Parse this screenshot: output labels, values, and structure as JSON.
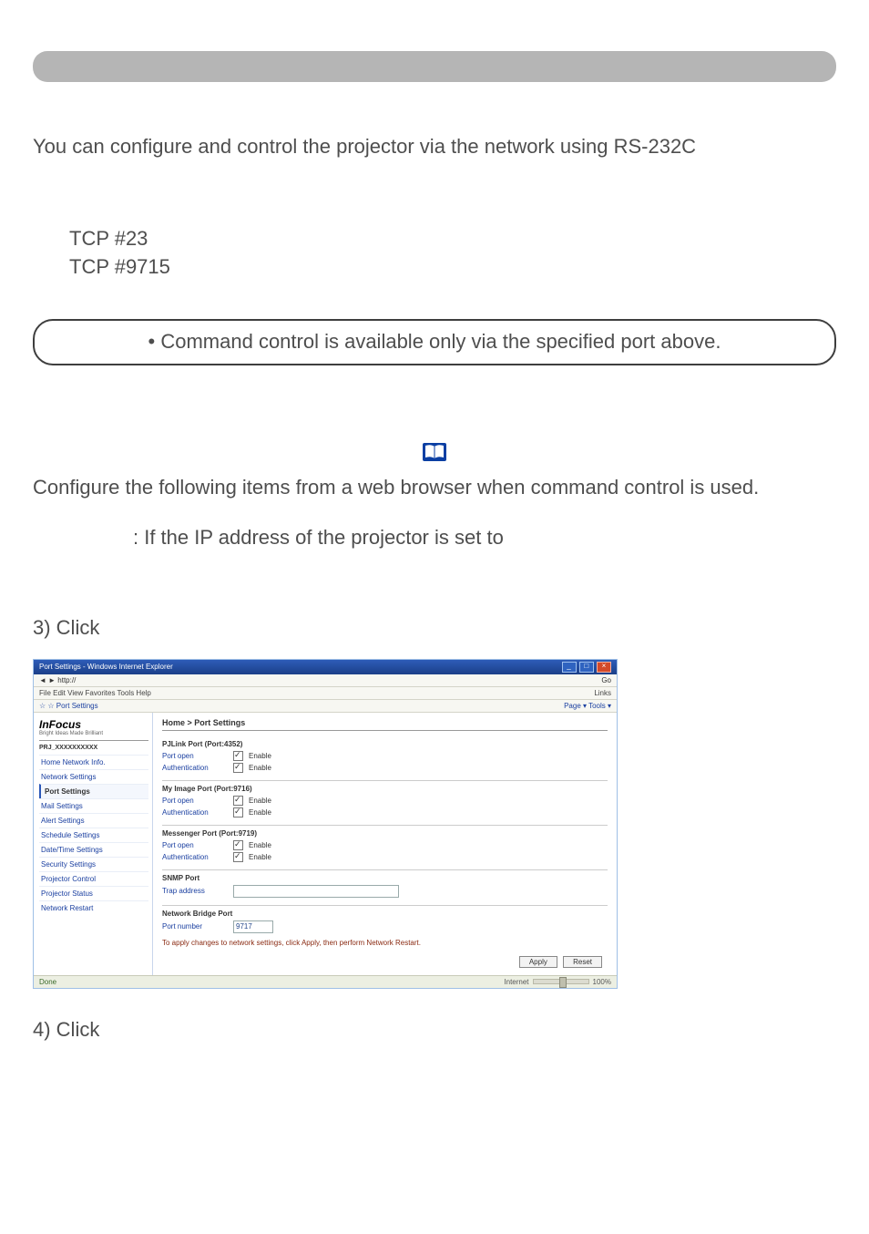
{
  "intro": "You can configure and control the projector via the network using RS-232C",
  "ports": {
    "tcp23": "TCP #23",
    "tcp9715": "TCP #9715"
  },
  "note_box": "• Command control is available only via the specified port above.",
  "configure_line": "Configure the following items from a web browser when command control is used.",
  "ip_line": ": If the IP address of the projector is set to",
  "step3": "3) Click",
  "step4": "4) Click",
  "screenshot": {
    "window_title": "Port Settings - Windows Internet Explorer",
    "address_prefix": "http://",
    "menu": "File  Edit  View  Favorites  Tools  Help",
    "links_label": "Links",
    "go_label": "Go",
    "fav_tab": "Port Settings",
    "toolbar_right": "Page ▾   Tools ▾",
    "logo": "InFocus",
    "logo_sub": "Bright Ideas Made Brilliant",
    "model": "PRJ_XXXXXXXXXX",
    "breadcrumb": "Home > Port Settings",
    "nav": [
      "Home Network Info.",
      "Network Settings",
      "Port Settings",
      "Mail Settings",
      "Alert Settings",
      "Schedule Settings",
      "Date/Time Settings",
      "Security Settings",
      "Projector Control",
      "Projector Status",
      "Network Restart"
    ],
    "nav_active_index": 2,
    "sections": {
      "pjlink": {
        "title": "PJLink Port (Port:4352)",
        "port_open_label": "Port open",
        "auth_label": "Authentication",
        "enable": "Enable"
      },
      "myimage": {
        "title": "My Image Port (Port:9716)",
        "port_open_label": "Port open",
        "auth_label": "Authentication",
        "enable": "Enable"
      },
      "messenger": {
        "title": "Messenger Port (Port:9719)",
        "port_open_label": "Port open",
        "auth_label": "Authentication",
        "enable": "Enable"
      },
      "snmp": {
        "title": "SNMP Port",
        "trap_label": "Trap address"
      },
      "bridge": {
        "title": "Network Bridge Port",
        "portnum_label": "Port number",
        "portnum_value": "9717"
      }
    },
    "apply_note": "To apply changes to network settings, click Apply, then perform Network Restart.",
    "btn_apply": "Apply",
    "btn_reset": "Reset",
    "status_left": "Done",
    "status_zone": "Internet",
    "status_zoom": "100%"
  }
}
